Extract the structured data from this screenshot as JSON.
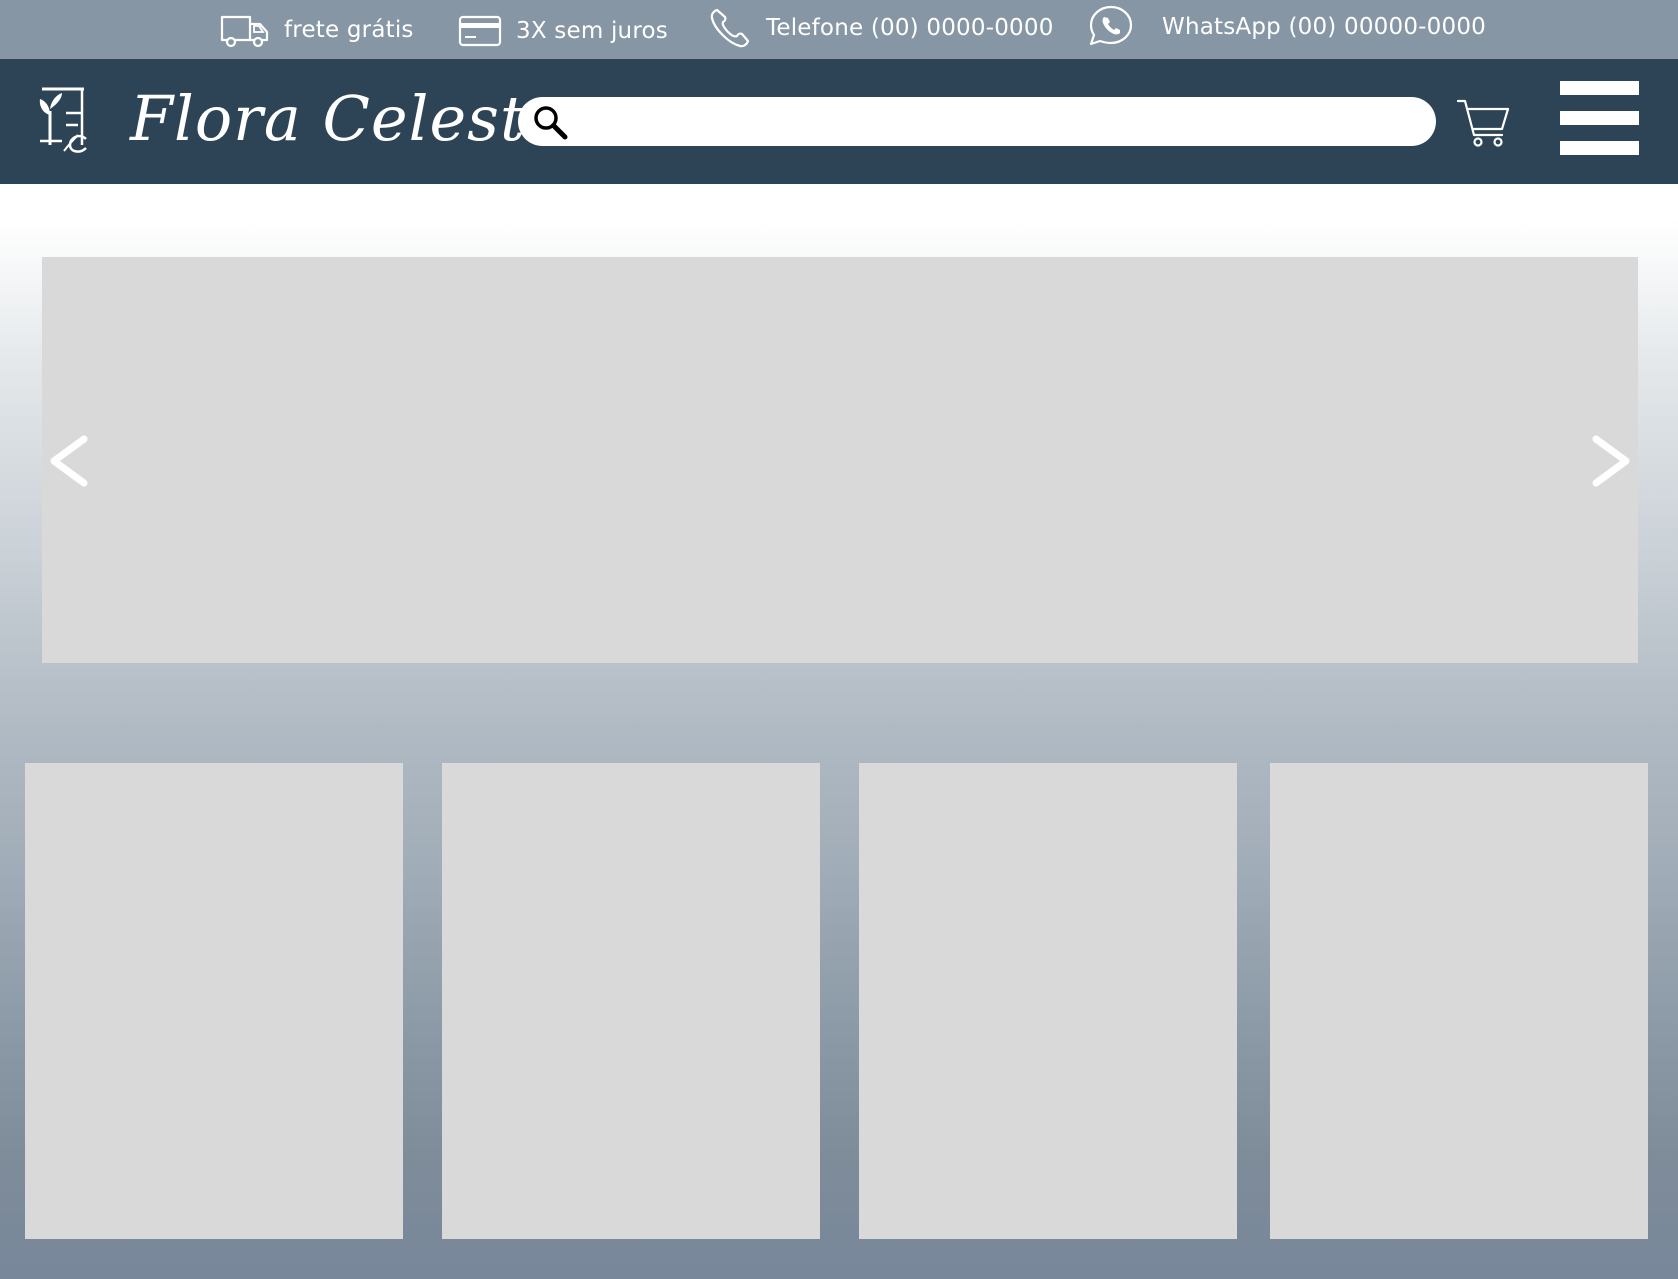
{
  "topbar": {
    "shipping": {
      "label": "frete grátis",
      "icon": "truck-icon"
    },
    "installments": {
      "label": "3X sem juros",
      "icon": "credit-card-icon"
    },
    "phone": {
      "label": "Telefone (00) 0000-0000",
      "icon": "phone-icon"
    },
    "whatsapp": {
      "label": "WhatsApp (00) 00000-0000",
      "icon": "whatsapp-icon"
    }
  },
  "header": {
    "logo_text": "Flora Celeste",
    "logo_mark": "FC",
    "search": {
      "placeholder": "",
      "value": "",
      "icon": "search-icon"
    },
    "cart_icon": "cart-icon",
    "menu_icon": "hamburger-menu-icon"
  },
  "carousel": {
    "prev_icon": "chevron-left-icon",
    "next_icon": "chevron-right-icon"
  },
  "products": [
    {
      "id": "product-card-1"
    },
    {
      "id": "product-card-2"
    },
    {
      "id": "product-card-3"
    },
    {
      "id": "product-card-4"
    }
  ],
  "colors": {
    "topbar_bg": "#8796a5",
    "header_bg": "#2c4456",
    "placeholder_gray": "#d9d9d9",
    "text_light": "#ffffff"
  }
}
